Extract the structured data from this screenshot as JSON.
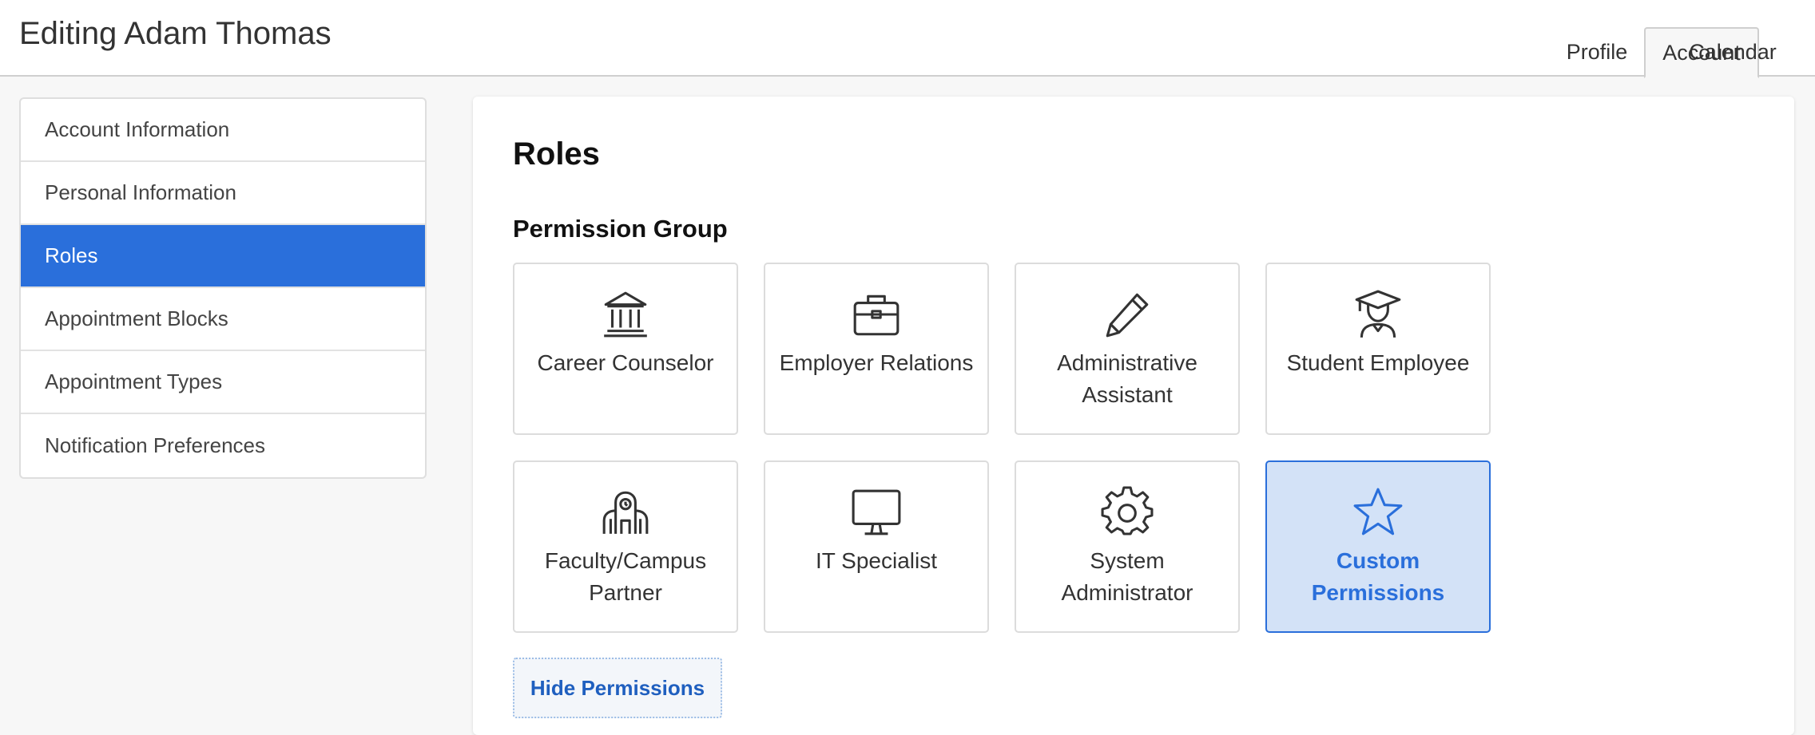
{
  "header": {
    "title": "Editing Adam Thomas",
    "tabs": [
      {
        "label": "Profile"
      },
      {
        "label": "Account"
      },
      {
        "label": "Calendar"
      }
    ]
  },
  "sidebar": {
    "items": [
      {
        "label": "Account Information"
      },
      {
        "label": "Personal Information"
      },
      {
        "label": "Roles"
      },
      {
        "label": "Appointment Blocks"
      },
      {
        "label": "Appointment Types"
      },
      {
        "label": "Notification Preferences"
      }
    ],
    "active": "Roles"
  },
  "main": {
    "title": "Roles",
    "group_title": "Permission Group",
    "cards": [
      {
        "label": "Career Counselor",
        "icon": "bank-icon"
      },
      {
        "label": "Employer Relations",
        "icon": "briefcase-icon"
      },
      {
        "label": "Administrative Assistant",
        "icon": "pencil-icon"
      },
      {
        "label": "Student Employee",
        "icon": "graduate-icon"
      },
      {
        "label": "Faculty/Campus Partner",
        "icon": "school-building-icon"
      },
      {
        "label": "IT Specialist",
        "icon": "monitor-icon"
      },
      {
        "label": "System Administrator",
        "icon": "gear-icon"
      },
      {
        "label": "Custom Permissions",
        "icon": "star-icon"
      }
    ],
    "selected_card": "Custom Permissions",
    "hide_button_label": "Hide Permissions"
  },
  "colors": {
    "accent": "#2a6fdb",
    "selected_bg": "#d3e2f7",
    "link": "#1f5fbf"
  }
}
